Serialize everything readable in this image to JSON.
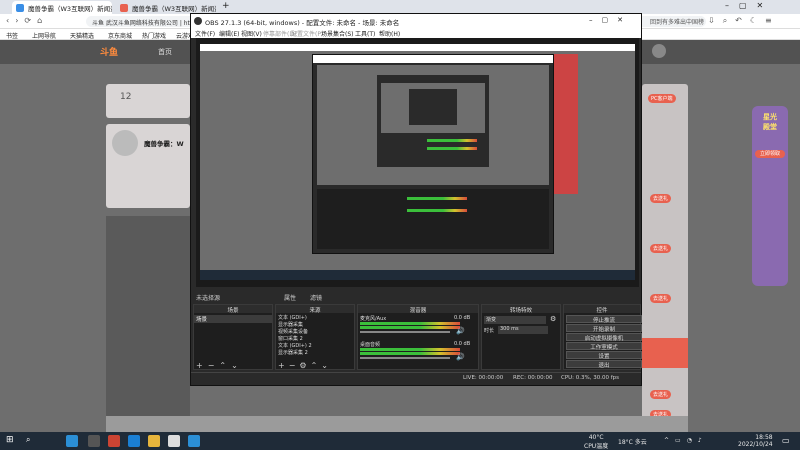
{
  "browser": {
    "tabs": [
      {
        "title": "魔兽争霸（W3互联网）新闻资讯",
        "active": true
      },
      {
        "title": "魔兽争霸（W3互联网）新闻资讯",
        "active": false
      }
    ],
    "new_tab": "+",
    "url": "斗鱼 武汉斗鱼网络科技有限公司 | https://www.douyu.com",
    "site_label": "回到有多难出中国榜",
    "bookmarks": [
      "书签",
      "上网导航",
      "天猫精选",
      "京东商城",
      "热门游戏",
      "云游戏"
    ]
  },
  "site": {
    "logo": "斗鱼",
    "nav_home": "首页",
    "card_count": "12",
    "streamer_name": "魔兽争霸：W",
    "ad_title": "星光\n殿堂",
    "ad_button": "立即领取",
    "follow_label": "关注",
    "right_buttons": [
      "PC客户端",
      "去送礼",
      "去送礼",
      "去送礼",
      "去送礼",
      "去送礼",
      "去送礼",
      "去送礼"
    ]
  },
  "obs": {
    "title": "OBS 27.1.3 (64-bit, windows) - 配置文件: 未命名 - 场景: 未命名",
    "menu": [
      "文件(F)",
      "编辑(E)",
      "视图(V)",
      "停靠部件(D)",
      "配置文件(P)",
      "场景集合(S)",
      "工具(T)",
      "帮助(H)"
    ],
    "scene_bar": "未选择源",
    "scene_props": [
      "属性",
      "滤镜"
    ],
    "docks": {
      "scenes": {
        "title": "场景",
        "items": [
          "场景"
        ]
      },
      "sources": {
        "title": "来源",
        "items": [
          "文本 (GDI+)",
          "显示器采集",
          "视频采集设备",
          "窗口采集 2",
          "文本 (GDI+) 2",
          "显示器采集 2"
        ]
      },
      "mixer": {
        "title": "混音器",
        "channels": [
          {
            "name": "麦克风/Aux",
            "db": "0.0 dB"
          },
          {
            "name": "桌面音频",
            "db": "0.0 dB"
          }
        ]
      },
      "transitions": {
        "title": "转场特效",
        "type": "渐变",
        "duration_label": "时长",
        "duration": "300 ms"
      },
      "controls": {
        "title": "控件",
        "buttons": [
          "停止推流",
          "开始录制",
          "启动虚拟摄像机",
          "工作室模式",
          "设置",
          "退出"
        ]
      }
    },
    "status": {
      "live": "LIVE: 00:00:00",
      "rec": "REC: 00:00:00",
      "cpu": "CPU: 0.3%, 30.00 fps"
    }
  },
  "taskbar": {
    "temp_line1": "40°C",
    "temp_line2": "CPU温度",
    "weather": "18°C 多云",
    "time": "18:58",
    "date": "2022/10/24"
  },
  "colors": {
    "accent": "#e8614f",
    "obs_bg": "#2a2a2a",
    "taskbar": "#1f2b38"
  }
}
